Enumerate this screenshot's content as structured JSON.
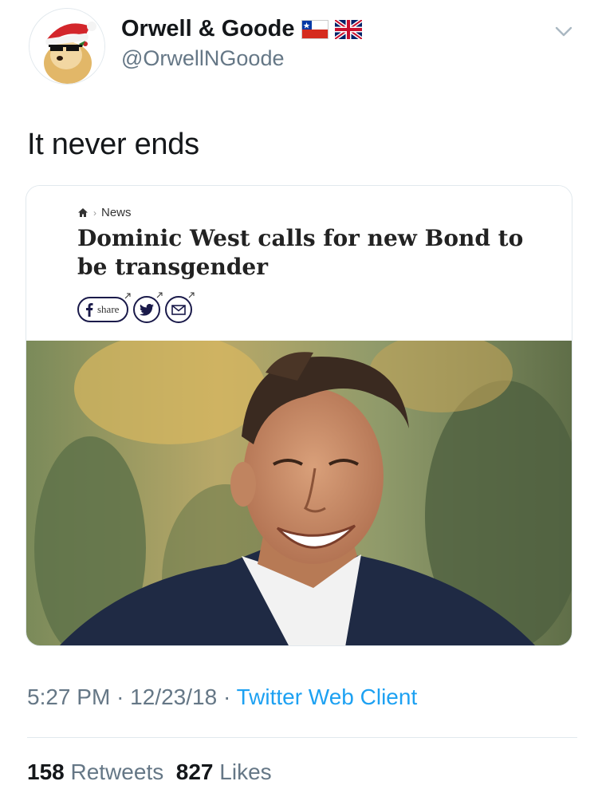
{
  "user": {
    "display_name": "Orwell & Goode",
    "handle": "@OrwellNGoode",
    "avatar_icon": "doge-santa-hat-avatar",
    "flags": [
      "chile-flag-icon",
      "uk-flag-icon"
    ]
  },
  "tweet": {
    "text": "It never ends"
  },
  "card": {
    "breadcrumb_home_icon": "home-icon",
    "breadcrumb_label": "News",
    "headline": "Dominic West calls for new Bond to be transgender",
    "share_label": "share",
    "share_icons": [
      "facebook-icon",
      "twitter-icon",
      "email-icon"
    ]
  },
  "meta": {
    "time": "5:27 PM",
    "sep1": "·",
    "date": "12/23/18",
    "sep2": "·",
    "client": "Twitter Web Client"
  },
  "stats": {
    "retweets_count": "158",
    "retweets_label": "Retweets",
    "likes_count": "827",
    "likes_label": "Likes"
  },
  "colors": {
    "link_blue": "#1da1f2",
    "secondary_gray": "#657786",
    "text_dark": "#14171a"
  }
}
